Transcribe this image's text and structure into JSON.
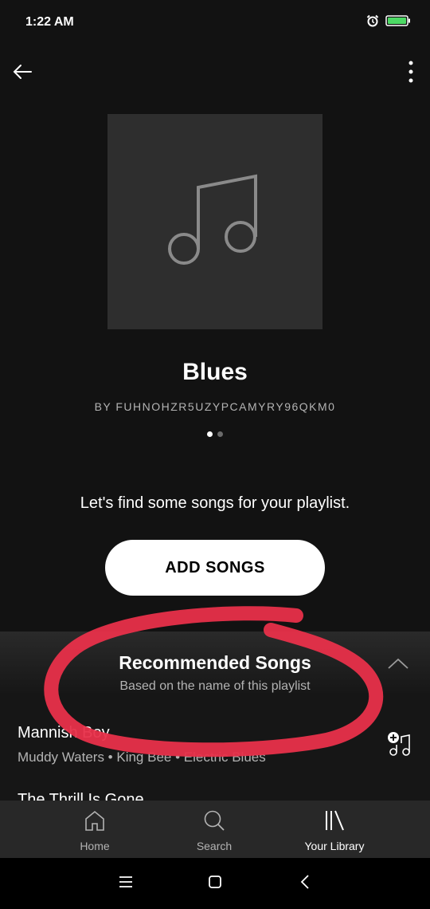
{
  "status_bar": {
    "time": "1:22 AM",
    "icons": [
      "alarm-icon",
      "battery-icon"
    ],
    "battery_color": "#4cd964"
  },
  "top_bar": {
    "back_icon": "arrow-left-icon",
    "more_icon": "vertical-dots-icon"
  },
  "playlist": {
    "cover_icon": "music-note-icon",
    "title": "Blues",
    "owner": "BY FUHNOHZR5UZYPCAMYRY96QKM0",
    "pager_count": 2,
    "pager_active": 0
  },
  "empty_state": {
    "prompt": "Let's find some songs for your playlist.",
    "add_songs_label": "ADD SONGS"
  },
  "recommended": {
    "title": "Recommended Songs",
    "subtitle": "Based on the name of this playlist",
    "collapse_icon": "chevron-up-icon",
    "songs": [
      {
        "title": "Mannish Boy",
        "meta": "Muddy Waters • King Bee • Electric Blues",
        "action_icon": "add-to-playlist-icon"
      },
      {
        "title": "The Thrill Is Gone"
      }
    ]
  },
  "annotation": {
    "color": "#e8304a"
  },
  "bottom_nav": {
    "items": [
      {
        "label": "Home",
        "icon": "home-icon"
      },
      {
        "label": "Search",
        "icon": "search-icon"
      },
      {
        "label": "Your Library",
        "icon": "library-icon",
        "active": true
      }
    ]
  },
  "system_nav": {
    "icons": [
      "menu-icon",
      "home-square-icon",
      "back-chevron-icon"
    ]
  }
}
